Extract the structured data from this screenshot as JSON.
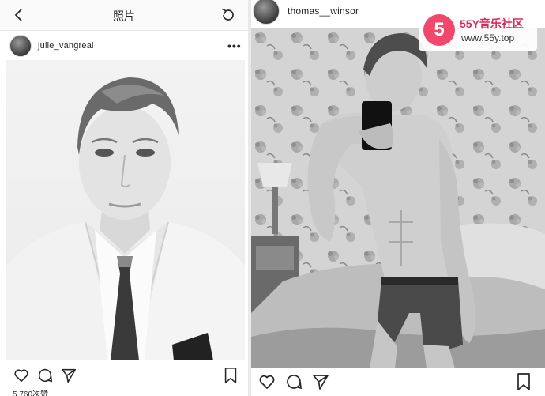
{
  "left": {
    "nav": {
      "title": "照片"
    },
    "post": {
      "username": "julie_vangreal",
      "more_label": "•••",
      "likes_text": "5,760次赞"
    }
  },
  "right": {
    "post": {
      "username": "thomas__winsor"
    }
  },
  "watermark": {
    "logo_glyph": "5",
    "name": "55Y音乐社区",
    "url": "www.55y.top"
  },
  "colors": {
    "text": "#262626",
    "border": "#e6e6e6",
    "watermark_accent": "#f0476a"
  },
  "icons": [
    "back-icon",
    "refresh-icon",
    "heart-icon",
    "comment-icon",
    "share-icon",
    "bookmark-icon",
    "more-icon"
  ]
}
